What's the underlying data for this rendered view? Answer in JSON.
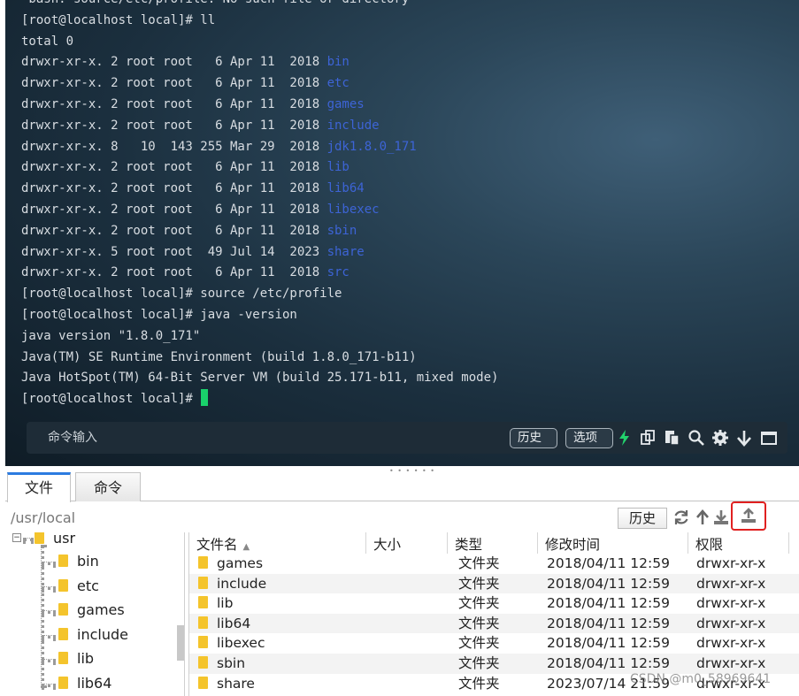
{
  "terminal": {
    "lines": [
      {
        "text": "-bash: source/etc/profile: No such file or directory",
        "dir": ""
      },
      {
        "text": "[root@localhost local]# ll",
        "dir": ""
      },
      {
        "text": "total 0",
        "dir": ""
      },
      {
        "text": "drwxr-xr-x. 2 root root   6 Apr 11  2018 ",
        "dir": "bin"
      },
      {
        "text": "drwxr-xr-x. 2 root root   6 Apr 11  2018 ",
        "dir": "etc"
      },
      {
        "text": "drwxr-xr-x. 2 root root   6 Apr 11  2018 ",
        "dir": "games"
      },
      {
        "text": "drwxr-xr-x. 2 root root   6 Apr 11  2018 ",
        "dir": "include"
      },
      {
        "text": "drwxr-xr-x. 8   10  143 255 Mar 29  2018 ",
        "dir": "jdk1.8.0_171"
      },
      {
        "text": "drwxr-xr-x. 2 root root   6 Apr 11  2018 ",
        "dir": "lib"
      },
      {
        "text": "drwxr-xr-x. 2 root root   6 Apr 11  2018 ",
        "dir": "lib64"
      },
      {
        "text": "drwxr-xr-x. 2 root root   6 Apr 11  2018 ",
        "dir": "libexec"
      },
      {
        "text": "drwxr-xr-x. 2 root root   6 Apr 11  2018 ",
        "dir": "sbin"
      },
      {
        "text": "drwxr-xr-x. 5 root root  49 Jul 14  2023 ",
        "dir": "share"
      },
      {
        "text": "drwxr-xr-x. 2 root root   6 Apr 11  2018 ",
        "dir": "src"
      },
      {
        "text": "[root@localhost local]# source /etc/profile",
        "dir": ""
      },
      {
        "text": "[root@localhost local]# java -version",
        "dir": ""
      },
      {
        "text": "java version \"1.8.0_171\"",
        "dir": ""
      },
      {
        "text": "Java(TM) SE Runtime Environment (build 1.8.0_171-b11)",
        "dir": ""
      },
      {
        "text": "Java HotSpot(TM) 64-Bit Server VM (build 25.171-b11, mixed mode)",
        "dir": ""
      }
    ],
    "prompt": "[root@localhost local]# ",
    "cmdbar": {
      "placeholder": "命令输入",
      "history_label": "历史",
      "options_label": "选项"
    }
  },
  "tabs": {
    "files_label": "文件",
    "commands_label": "命令"
  },
  "pathbar": {
    "path": "/usr/local",
    "history_label": "历史"
  },
  "tree": {
    "root": "usr",
    "children": [
      "bin",
      "etc",
      "games",
      "include",
      "lib",
      "lib64"
    ]
  },
  "files": {
    "columns": [
      "文件名",
      "大小",
      "类型",
      "修改时间",
      "权限"
    ],
    "rows": [
      {
        "name": "games",
        "size": "",
        "type": "文件夹",
        "modified": "2018/04/11 12:59",
        "perm": "drwxr-xr-x"
      },
      {
        "name": "include",
        "size": "",
        "type": "文件夹",
        "modified": "2018/04/11 12:59",
        "perm": "drwxr-xr-x"
      },
      {
        "name": "lib",
        "size": "",
        "type": "文件夹",
        "modified": "2018/04/11 12:59",
        "perm": "drwxr-xr-x"
      },
      {
        "name": "lib64",
        "size": "",
        "type": "文件夹",
        "modified": "2018/04/11 12:59",
        "perm": "drwxr-xr-x"
      },
      {
        "name": "libexec",
        "size": "",
        "type": "文件夹",
        "modified": "2018/04/11 12:59",
        "perm": "drwxr-xr-x"
      },
      {
        "name": "sbin",
        "size": "",
        "type": "文件夹",
        "modified": "2018/04/11 12:59",
        "perm": "drwxr-xr-x"
      },
      {
        "name": "share",
        "size": "",
        "type": "文件夹",
        "modified": "2023/07/14 21:59",
        "perm": "drwxr-xr-x"
      }
    ]
  },
  "watermark": "CSDN @m0_58969641",
  "colors": {
    "dir_blue": "#3d64d6",
    "cursor_green": "#19d26b",
    "tab_accent": "#2c7be0",
    "highlight_red": "#e02020",
    "folder_yellow": "#f4c42c"
  }
}
